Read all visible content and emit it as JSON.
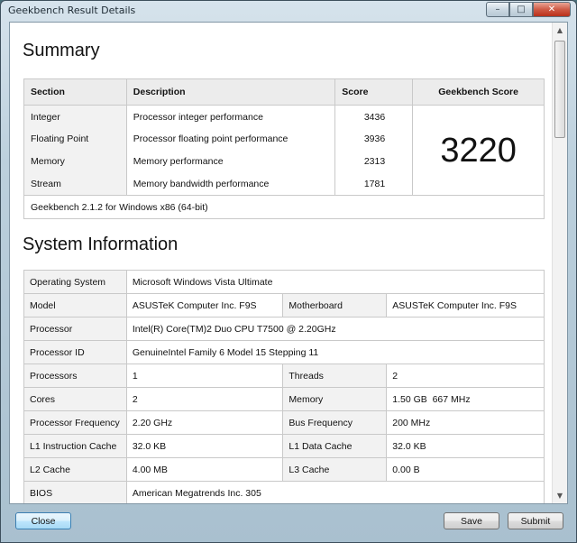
{
  "window": {
    "title": "Geekbench Result Details",
    "controls": {
      "minimize": "–",
      "maximize": "□",
      "close": "✕"
    }
  },
  "summary": {
    "heading": "Summary",
    "columns": {
      "section": "Section",
      "description": "Description",
      "score": "Score",
      "geekbench_score": "Geekbench Score"
    },
    "rows": [
      {
        "section": "Integer",
        "description": "Processor integer performance",
        "score": "3436"
      },
      {
        "section": "Floating Point",
        "description": "Processor floating point performance",
        "score": "3936"
      },
      {
        "section": "Memory",
        "description": "Memory performance",
        "score": "2313"
      },
      {
        "section": "Stream",
        "description": "Memory bandwidth performance",
        "score": "1781"
      }
    ],
    "geekbench_score": "3220",
    "footer": "Geekbench 2.1.2 for Windows x86 (64-bit)"
  },
  "system_info": {
    "heading": "System Information",
    "operating_system": {
      "label": "Operating System",
      "value": "Microsoft Windows Vista Ultimate"
    },
    "model": {
      "label": "Model",
      "value": "ASUSTeK Computer Inc. F9S"
    },
    "motherboard": {
      "label": "Motherboard",
      "value": "ASUSTeK Computer Inc. F9S"
    },
    "processor": {
      "label": "Processor",
      "value": "Intel(R) Core(TM)2 Duo CPU T7500 @ 2.20GHz"
    },
    "processor_id": {
      "label": "Processor ID",
      "value": "GenuineIntel Family 6 Model 15 Stepping 11"
    },
    "processors": {
      "label": "Processors",
      "value": "1"
    },
    "threads": {
      "label": "Threads",
      "value": "2"
    },
    "cores": {
      "label": "Cores",
      "value": "2"
    },
    "memory": {
      "label": "Memory",
      "value": "1.50 GB  667 MHz"
    },
    "processor_frequency": {
      "label": "Processor Frequency",
      "value": "2.20 GHz"
    },
    "bus_frequency": {
      "label": "Bus Frequency",
      "value": "200 MHz"
    },
    "l1_instruction_cache": {
      "label": "L1 Instruction Cache",
      "value": "32.0 KB"
    },
    "l1_data_cache": {
      "label": "L1 Data Cache",
      "value": "32.0 KB"
    },
    "l2_cache": {
      "label": "L2 Cache",
      "value": "4.00 MB"
    },
    "l3_cache": {
      "label": "L3 Cache",
      "value": "0.00 B"
    },
    "bios": {
      "label": "BIOS",
      "value": "American Megatrends Inc. 305"
    }
  },
  "buttons": {
    "close": "Close",
    "save": "Save",
    "submit": "Submit"
  }
}
